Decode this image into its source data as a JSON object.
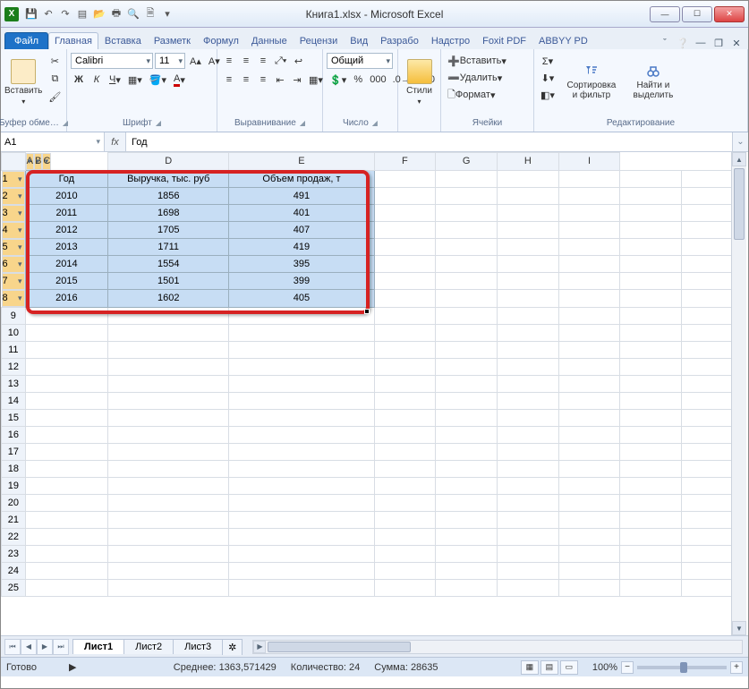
{
  "window": {
    "title": "Книга1.xlsx - Microsoft Excel",
    "sys_letter": "X"
  },
  "qat": [
    "save-icon",
    "undo-icon",
    "redo-icon",
    "new-icon",
    "open-icon",
    "print-icon",
    "preview-icon",
    "quickprint-icon"
  ],
  "tabs": {
    "file": "Файл",
    "items": [
      "Главная",
      "Вставка",
      "Разметк",
      "Формул",
      "Данные",
      "Рецензи",
      "Вид",
      "Разрабо",
      "Надстро",
      "Foxit PDF",
      "ABBYY PD"
    ],
    "active": 0
  },
  "ribbon": {
    "clipboard": {
      "paste": "Вставить",
      "label": "Буфер обме…"
    },
    "font": {
      "name": "Calibri",
      "size": "11",
      "label": "Шрифт"
    },
    "align": {
      "label": "Выравнивание"
    },
    "number": {
      "format": "Общий",
      "label": "Число"
    },
    "styles": {
      "btn": "Стили",
      "label": ""
    },
    "cells": {
      "insert": "Вставить",
      "delete": "Удалить",
      "format": "Формат",
      "label": "Ячейки"
    },
    "editing": {
      "sort": "Сортировка\nи фильтр",
      "find": "Найти и\nвыделить",
      "label": "Редактирование"
    }
  },
  "formula_bar": {
    "name_box": "A1",
    "fx": "fx",
    "formula": "Год"
  },
  "columns": [
    "A",
    "B",
    "C",
    "D",
    "E",
    "F",
    "G",
    "H",
    "I"
  ],
  "chart_data": {
    "type": "table",
    "headers": [
      "Год",
      "Выручка, тыс. руб",
      "Объем продаж, т"
    ],
    "rows": [
      [
        "2010",
        "1856",
        "491"
      ],
      [
        "2011",
        "1698",
        "401"
      ],
      [
        "2012",
        "1705",
        "407"
      ],
      [
        "2013",
        "1711",
        "419"
      ],
      [
        "2014",
        "1554",
        "395"
      ],
      [
        "2015",
        "1501",
        "399"
      ],
      [
        "2016",
        "1602",
        "405"
      ]
    ]
  },
  "visible_rows": 25,
  "sheets": {
    "items": [
      "Лист1",
      "Лист2",
      "Лист3"
    ],
    "active": 0
  },
  "status": {
    "ready": "Готово",
    "avg_label": "Среднее:",
    "avg": "1363,571429",
    "count_label": "Количество:",
    "count": "24",
    "sum_label": "Сумма:",
    "sum": "28635",
    "zoom": "100%"
  }
}
